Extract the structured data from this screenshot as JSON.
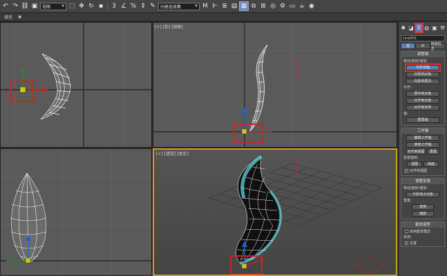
{
  "toolbar": {
    "view_dropdown": "视图",
    "selection_set_dropdown": "创建选择集"
  },
  "ribbon": {
    "tab_label": "填充"
  },
  "viewports": {
    "front_label": "[+] [前] [线框]",
    "persp_label": "[+] [透视] [真实]"
  },
  "panel": {
    "object_name": "Line001",
    "subtabs": [
      "轴",
      "IK",
      "链接信息"
    ],
    "adjust_pivot": {
      "title": "调整轴",
      "move_rotate_scale": "移动/旋转/缩放:",
      "affect_pivot_only": "仅影响轴",
      "affect_object_only": "仅影响对象",
      "affect_hierarchy_only": "仅影响层次",
      "align_label": "对齐:",
      "center_to_object": "居中到对象",
      "align_to_object": "对齐到对象",
      "align_to_world": "对齐到世界",
      "pivot_label": "轴:",
      "reset_pivot": "重置轴"
    },
    "working_pivot": {
      "title": "工作轴",
      "edit_working_pivot": "编辑工作轴",
      "use_working_pivot": "使用工作轴",
      "align_to_view": "对齐到视图",
      "reset": "重置",
      "place_pivot_to": "放置轴到:",
      "view": "视图",
      "surface": "曲面",
      "align_to_view_check": "对齐到视图"
    },
    "adjust_transform": {
      "title": "调整变换",
      "move_rotate_scale": "移动/旋转/缩放:",
      "dont_affect_children": "不影响子对象",
      "reset_label": "重置:",
      "transform": "变换",
      "scale": "缩放"
    },
    "skin_pose": {
      "title": "蒙皮姿势",
      "enable_skin_pose": "启用蒙皮模式",
      "enabled_label": "启用:",
      "position": "位置"
    }
  }
}
